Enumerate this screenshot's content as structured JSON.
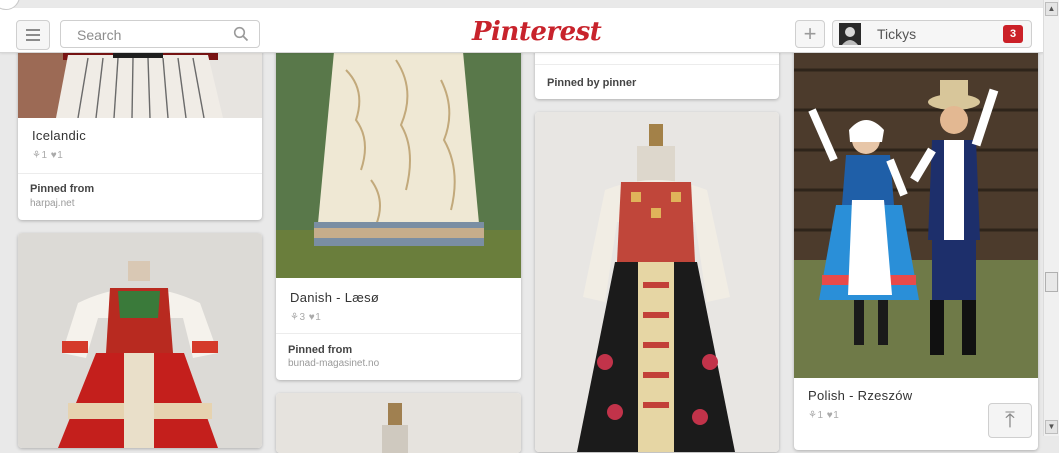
{
  "header": {
    "search_placeholder": "Search",
    "logo": "Pinterest",
    "add_label": "+",
    "user_name": "Tickys",
    "notification_count": "3"
  },
  "pins": [
    {
      "title": "Icelandic",
      "stats": "⚘1  ♥1",
      "footer_a": "Pinned from",
      "footer_b": "harpaj.net"
    },
    {
      "title": "Danish - Læsø",
      "stats": "⚘3  ♥1",
      "footer_a": "Pinned from",
      "footer_b": "bunad-magasinet.no"
    },
    {
      "footer_a": "Pinned by pinner"
    },
    {
      "title": "Polish - Rzeszów",
      "stats": "⚘1  ♥1"
    }
  ],
  "scroll_top_icon": "⤒",
  "colors": {
    "brand": "#c8232c",
    "notification": "#cb2027",
    "page_bg": "#e9e9e9"
  },
  "icons": {
    "menu": "hamburger-menu-icon",
    "search": "magnifier-icon",
    "add": "plus-icon",
    "scroll_top": "arrow-up-to-top-icon"
  }
}
